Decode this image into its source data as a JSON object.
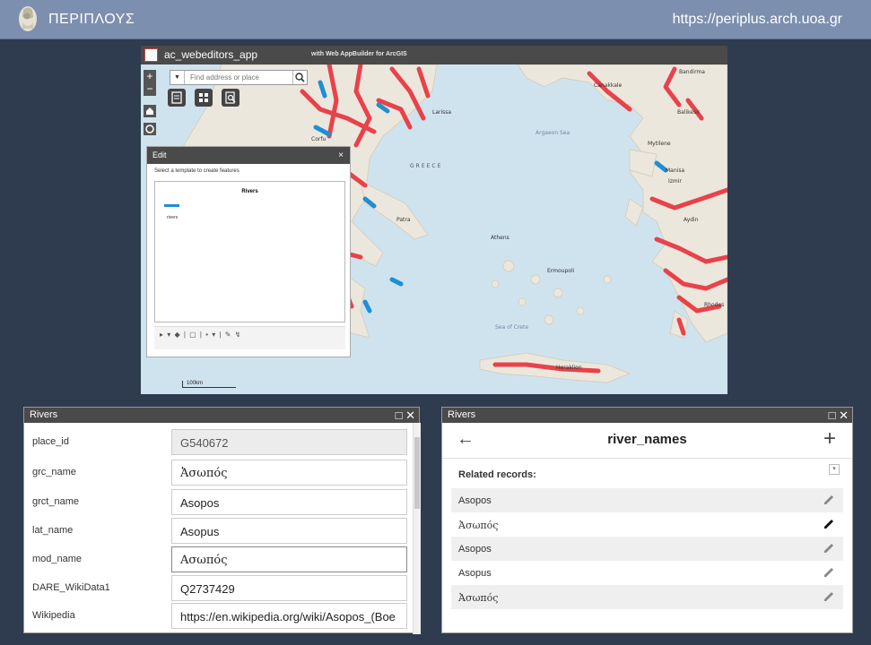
{
  "header": {
    "title": "ΠΕΡΙΠΛΟΥΣ",
    "url": "https://periplus.arch.uoa.gr"
  },
  "map_app": {
    "title": "ac_webeditors_app",
    "subtitle": "with Web AppBuilder for ArcGIS",
    "search_placeholder": "Find address or place",
    "zoom_in": "+",
    "zoom_out": "−",
    "scale": "100km",
    "place_labels": [
      "Bandirma",
      "Canakkale",
      "Balikesir",
      "Mytilene",
      "Manisa",
      "Izmir",
      "Aydin",
      "Rhodes",
      "Heraklion",
      "Ermoupoli",
      "Athens",
      "Patra",
      "Corfu",
      "Larissa",
      "Argaeon Sea",
      "Sea of Crete",
      "GREECE"
    ],
    "edit_panel": {
      "title": "Edit",
      "close": "×",
      "hint": "Select a template to create features",
      "group": "Rivers",
      "item": "rivers"
    }
  },
  "attributes_panel": {
    "title": "Rivers",
    "fields": [
      {
        "label": "place_id",
        "value": "G540672",
        "readonly": true
      },
      {
        "label": "grc_name",
        "value": "Ἀσωπός"
      },
      {
        "label": "grct_name",
        "value": "Asopos"
      },
      {
        "label": "lat_name",
        "value": "Asopus"
      },
      {
        "label": "mod_name",
        "value": "Ασωπός"
      },
      {
        "label": "DARE_WikiData1",
        "value": "Q2737429"
      },
      {
        "label": "Wikipedia",
        "value": "https://en.wikipedia.org/wiki/Asopos_(Boe"
      }
    ]
  },
  "related_panel": {
    "title": "Rivers",
    "heading": "river_names",
    "section": "Related records:",
    "records": [
      "Asopos",
      "Ἀσωπός",
      "Asopos",
      "Asopus",
      "Ἀσωπός"
    ]
  },
  "colors": {
    "header_bg": "#7d8fae",
    "page_bg": "#2f3b4f",
    "river_red": "#e8424a",
    "river_blue": "#1e8fd4",
    "land": "#ece7dd",
    "sea": "#cfe3ef"
  }
}
